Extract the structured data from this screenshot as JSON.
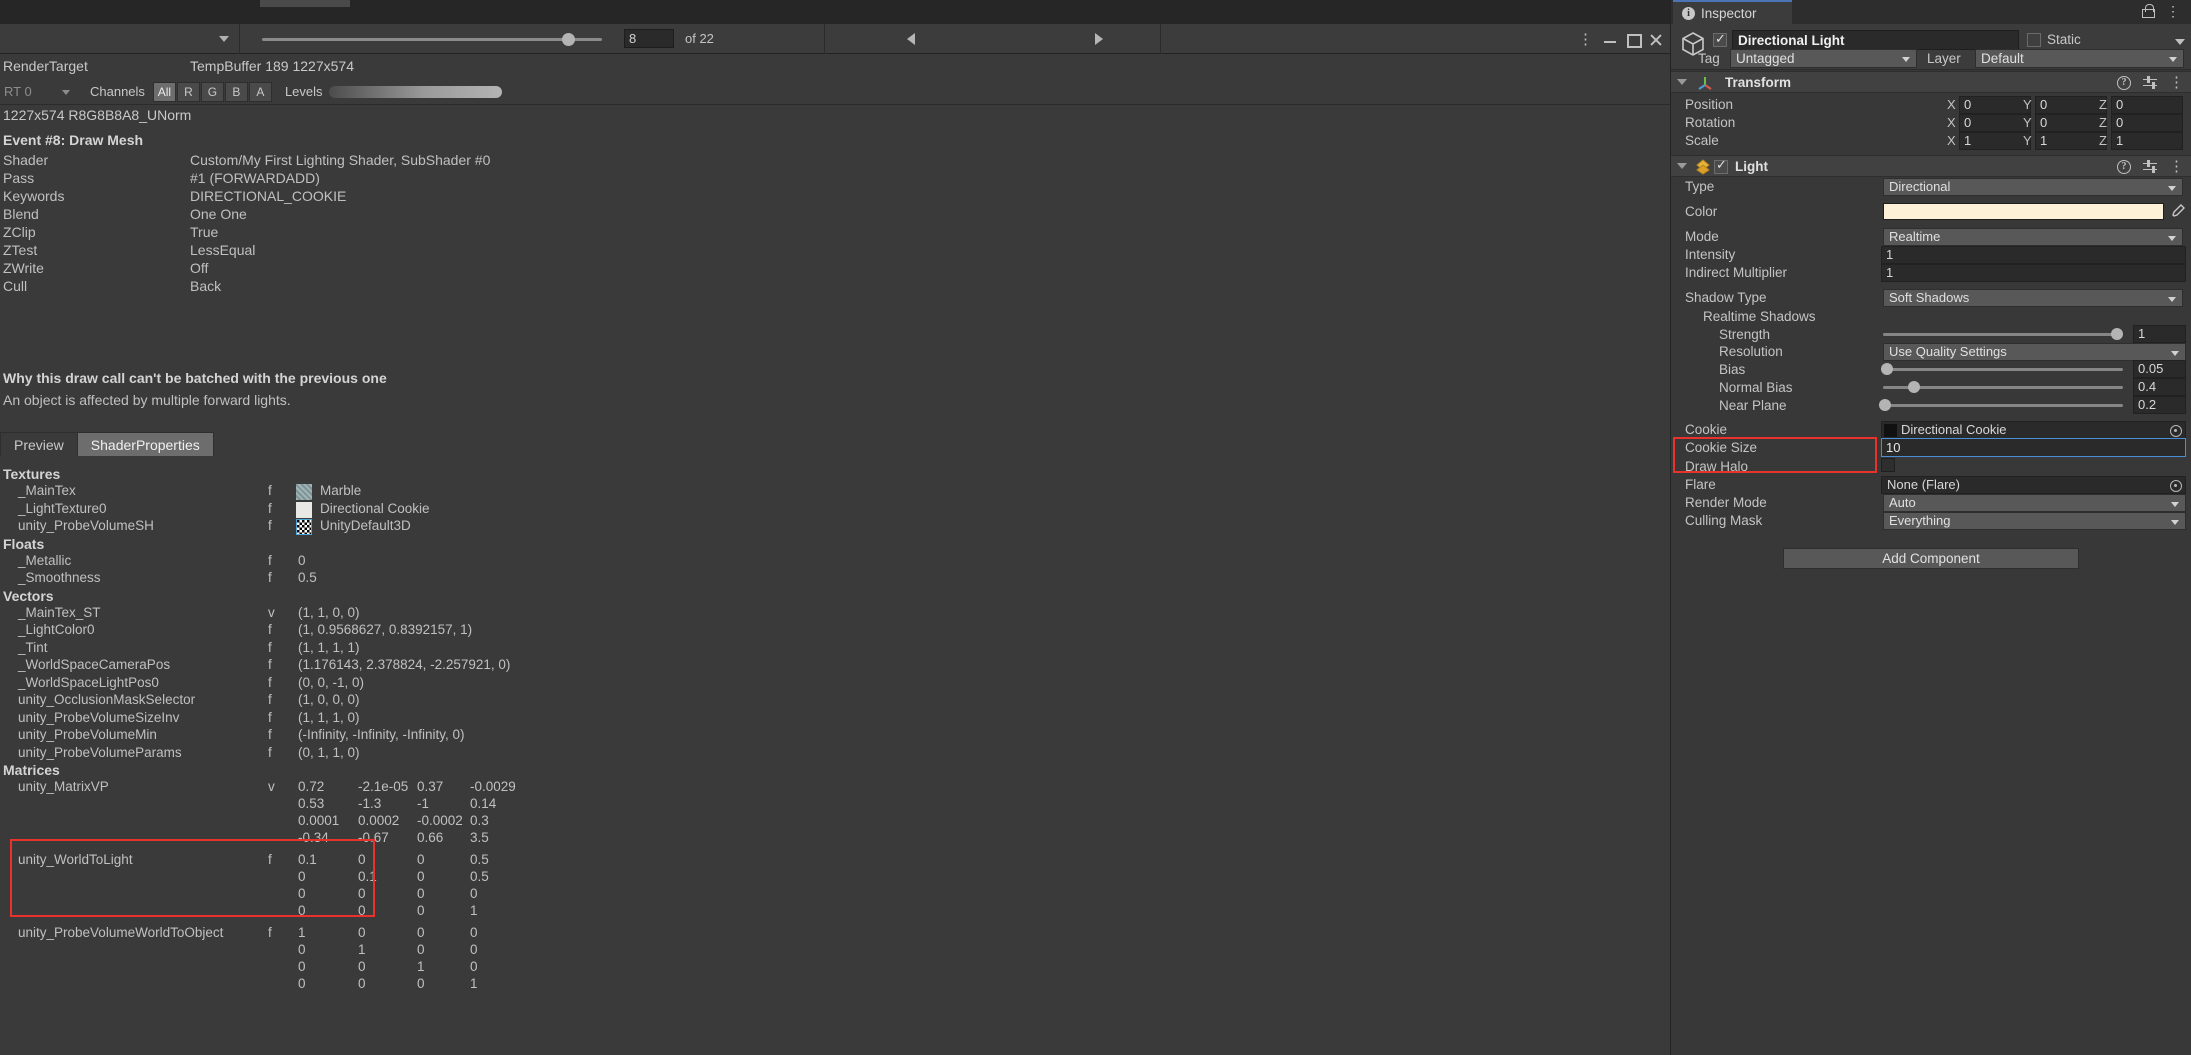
{
  "frame_debugger": {
    "toolbar": {
      "event_index": "8",
      "of_label": "of 22",
      "prev_icon": "triangle-left-icon",
      "next_icon": "triangle-right-icon",
      "kebab_icon": "kebab-menu-icon",
      "minimize_icon": "minimize-icon",
      "maximize_icon": "maximize-icon",
      "close_icon": "close-icon"
    },
    "render_target": {
      "label": "RenderTarget",
      "value": "TempBuffer 189 1227x574"
    },
    "channels": {
      "rt_label": "RT 0",
      "channels_label": "Channels",
      "buttons": [
        "All",
        "R",
        "G",
        "B",
        "A"
      ],
      "active_button": "All",
      "levels_label": "Levels"
    },
    "format_line": "1227x574 R8G8B8A8_UNorm",
    "event_title": "Event #8: Draw Mesh",
    "details": [
      {
        "key": "Shader",
        "value": "Custom/My First Lighting Shader, SubShader #0"
      },
      {
        "key": "Pass",
        "value": "#1 (FORWARDADD)"
      },
      {
        "key": "Keywords",
        "value": "DIRECTIONAL_COOKIE"
      },
      {
        "key": "Blend",
        "value": "One One"
      },
      {
        "key": "ZClip",
        "value": "True"
      },
      {
        "key": "ZTest",
        "value": "LessEqual"
      },
      {
        "key": "ZWrite",
        "value": "Off"
      },
      {
        "key": "Cull",
        "value": "Back"
      }
    ],
    "batch_title": "Why this draw call can't be batched with the previous one",
    "batch_reason": "An object is affected by multiple forward lights.",
    "tabs": [
      {
        "label": "Preview",
        "active": false
      },
      {
        "label": "ShaderProperties",
        "active": true
      }
    ],
    "sections": {
      "textures_head": "Textures",
      "textures": [
        {
          "name": "_MainTex",
          "type": "f",
          "value": "Marble",
          "swatch": "marble-texture-thumbnail"
        },
        {
          "name": "_LightTexture0",
          "type": "f",
          "value": "Directional Cookie",
          "swatch": "cookie-texture-thumbnail"
        },
        {
          "name": "unity_ProbeVolumeSH",
          "type": "f",
          "value": "UnityDefault3D",
          "swatch": "unity-default-3d-thumbnail"
        }
      ],
      "floats_head": "Floats",
      "floats": [
        {
          "name": "_Metallic",
          "type": "f",
          "value": "0"
        },
        {
          "name": "_Smoothness",
          "type": "f",
          "value": "0.5"
        }
      ],
      "vectors_head": "Vectors",
      "vectors": [
        {
          "name": "_MainTex_ST",
          "type": "v",
          "value": "(1, 1, 0, 0)"
        },
        {
          "name": "_LightColor0",
          "type": "f",
          "value": "(1, 0.9568627, 0.8392157, 1)"
        },
        {
          "name": "_Tint",
          "type": "f",
          "value": "(1, 1, 1, 1)"
        },
        {
          "name": "_WorldSpaceCameraPos",
          "type": "f",
          "value": "(1.176143, 2.378824, -2.257921, 0)"
        },
        {
          "name": "_WorldSpaceLightPos0",
          "type": "f",
          "value": "(0, 0, -1, 0)"
        },
        {
          "name": "unity_OcclusionMaskSelector",
          "type": "f",
          "value": "(1, 0, 0, 0)"
        },
        {
          "name": "unity_ProbeVolumeSizeInv",
          "type": "f",
          "value": "(1, 1, 1, 0)"
        },
        {
          "name": "unity_ProbeVolumeMin",
          "type": "f",
          "value": "(-Infinity, -Infinity, -Infinity, 0)"
        },
        {
          "name": "unity_ProbeVolumeParams",
          "type": "f",
          "value": "(0, 1, 1, 0)"
        }
      ],
      "matrices_head": "Matrices",
      "matrices": [
        {
          "name": "unity_MatrixVP",
          "type": "v",
          "highlighted": false,
          "rows": [
            [
              "0.72",
              "-2.1e-05",
              "0.37",
              "-0.0029"
            ],
            [
              "0.53",
              "-1.3",
              "-1",
              "0.14"
            ],
            [
              "0.0001",
              "0.0002",
              "-0.0002",
              "0.3"
            ],
            [
              "-0.34",
              "-0.67",
              "0.66",
              "3.5"
            ]
          ]
        },
        {
          "name": "unity_WorldToLight",
          "type": "f",
          "highlighted": true,
          "rows": [
            [
              "0.1",
              "0",
              "0",
              "0.5"
            ],
            [
              "0",
              "0.1",
              "0",
              "0.5"
            ],
            [
              "0",
              "0",
              "0",
              "0"
            ],
            [
              "0",
              "0",
              "0",
              "1"
            ]
          ]
        },
        {
          "name": "unity_ProbeVolumeWorldToObject",
          "type": "f",
          "highlighted": false,
          "rows": [
            [
              "1",
              "0",
              "0",
              "0"
            ],
            [
              "0",
              "1",
              "0",
              "0"
            ],
            [
              "0",
              "0",
              "1",
              "0"
            ],
            [
              "0",
              "0",
              "0",
              "1"
            ]
          ]
        }
      ]
    }
  },
  "inspector": {
    "tab_label": "Inspector",
    "tab_icon": "info-icon",
    "lock_icon": "lock-open-icon",
    "kebab_icon": "kebab-menu-icon",
    "object": {
      "enabled": true,
      "name": "Directional Light",
      "static_label": "Static",
      "static_checked": false,
      "tag_label": "Tag",
      "tag_value": "Untagged",
      "layer_label": "Layer",
      "layer_value": "Default",
      "gameobject_icon": "cube-icon"
    },
    "transform": {
      "title": "Transform",
      "icon": "transform-axis-icon",
      "help_icon": "help-icon",
      "preset_icon": "preset-icon",
      "kebab_icon": "kebab-menu-icon",
      "rows": [
        {
          "label": "Position",
          "x": "0",
          "y": "0",
          "z": "0"
        },
        {
          "label": "Rotation",
          "x": "0",
          "y": "0",
          "z": "0"
        },
        {
          "label": "Scale",
          "x": "1",
          "y": "1",
          "z": "1"
        }
      ],
      "axis_labels": [
        "X",
        "Y",
        "Z"
      ]
    },
    "light": {
      "title": "Light",
      "icon": "light-bulb-icon",
      "enabled": true,
      "help_icon": "help-icon",
      "preset_icon": "preset-icon",
      "kebab_icon": "kebab-menu-icon",
      "type_label": "Type",
      "type_value": "Directional",
      "color_label": "Color",
      "color_value": "#FDF2D8",
      "eyedropper_icon": "eyedropper-icon",
      "mode_label": "Mode",
      "mode_value": "Realtime",
      "intensity_label": "Intensity",
      "intensity_value": "1",
      "indirect_label": "Indirect Multiplier",
      "indirect_value": "1",
      "shadow_type_label": "Shadow Type",
      "shadow_type_value": "Soft Shadows",
      "realtime_shadows_label": "Realtime Shadows",
      "strength_label": "Strength",
      "strength_value": "1",
      "strength_pct": 100,
      "resolution_label": "Resolution",
      "resolution_value": "Use Quality Settings",
      "bias_label": "Bias",
      "bias_value": "0.05",
      "bias_pct": 3,
      "normal_bias_label": "Normal Bias",
      "normal_bias_value": "0.4",
      "normal_bias_pct": 14,
      "near_plane_label": "Near Plane",
      "near_plane_value": "0.2",
      "near_plane_pct": 1,
      "cookie_label": "Cookie",
      "cookie_value": "Directional Cookie",
      "cookie_size_label": "Cookie Size",
      "cookie_size_value": "10",
      "draw_halo_label": "Draw Halo",
      "draw_halo_checked": false,
      "flare_label": "Flare",
      "flare_value": "None (Flare)",
      "render_mode_label": "Render Mode",
      "render_mode_value": "Auto",
      "culling_mask_label": "Culling Mask",
      "culling_mask_value": "Everything",
      "object_picker_icon": "object-picker-icon"
    },
    "add_component_label": "Add Component"
  },
  "highlight_color": "#E8322B",
  "accent_color": "#4A8FD4"
}
